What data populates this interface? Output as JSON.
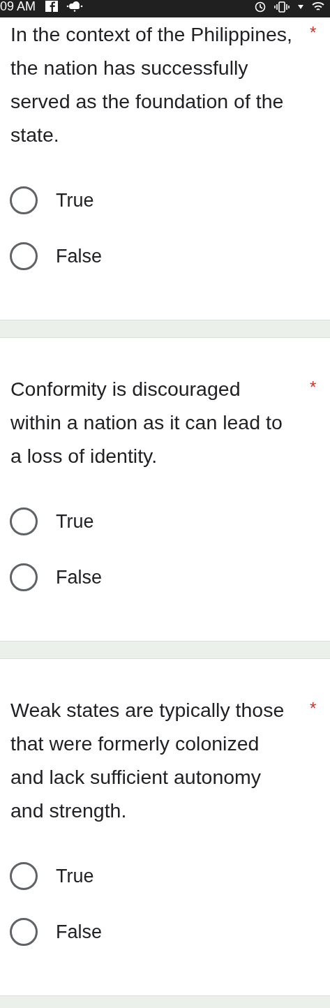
{
  "status_bar": {
    "time": "09 AM"
  },
  "questions": [
    {
      "text": "In the context of the Philippines, the nation has successfully served as the foundation of the state.",
      "required_mark": "*",
      "options": [
        {
          "label": "True",
          "selected": false
        },
        {
          "label": "False",
          "selected": false
        }
      ]
    },
    {
      "text": "Conformity is discouraged within a nation as it can lead to a loss of identity.",
      "required_mark": "*",
      "options": [
        {
          "label": "True",
          "selected": false
        },
        {
          "label": "False",
          "selected": false
        }
      ]
    },
    {
      "text": "Weak states are typically those that were formerly colonized and lack sufficient autonomy and strength.",
      "required_mark": "*",
      "options": [
        {
          "label": "True",
          "selected": false
        },
        {
          "label": "False",
          "selected": false
        }
      ]
    }
  ]
}
